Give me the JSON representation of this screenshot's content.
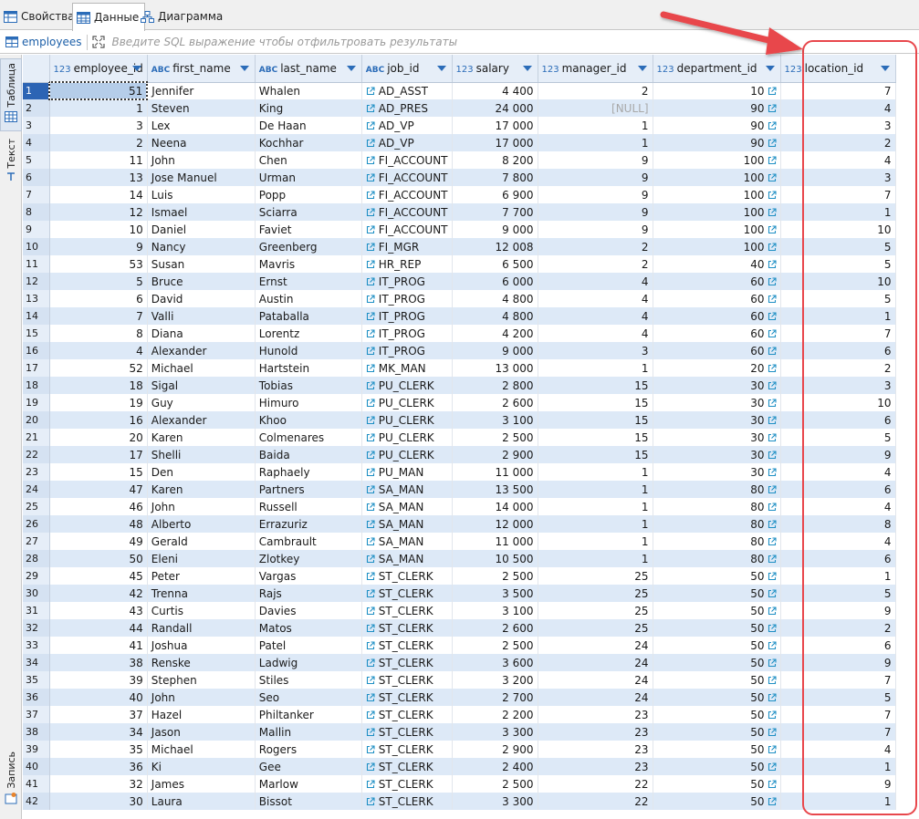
{
  "tabs": [
    {
      "label": "Свойства",
      "icon": "properties-table-icon"
    },
    {
      "label": "Данные",
      "icon": "data-grid-icon"
    },
    {
      "label": "Диаграмма",
      "icon": "diagram-icon"
    }
  ],
  "filter": {
    "entity_name": "employees",
    "placeholder": "Введите SQL выражение чтобы отфильтровать результаты"
  },
  "side_tabs": {
    "table": "Таблица",
    "text": "Текст",
    "record": "Запись"
  },
  "columns": [
    {
      "name": "employee_id",
      "type": "123"
    },
    {
      "name": "first_name",
      "type": "ABC"
    },
    {
      "name": "last_name",
      "type": "ABC"
    },
    {
      "name": "job_id",
      "type": "ABC"
    },
    {
      "name": "salary",
      "type": "123"
    },
    {
      "name": "manager_id",
      "type": "123"
    },
    {
      "name": "department_id",
      "type": "123"
    },
    {
      "name": "location_id",
      "type": "123"
    }
  ],
  "rows": [
    [
      "1",
      "51",
      "Jennifer",
      "Whalen",
      "AD_ASST",
      "4 400",
      "2",
      "10",
      "7"
    ],
    [
      "2",
      "1",
      "Steven",
      "King",
      "AD_PRES",
      "24 000",
      "[NULL]",
      "90",
      "4"
    ],
    [
      "3",
      "3",
      "Lex",
      "De Haan",
      "AD_VP",
      "17 000",
      "1",
      "90",
      "3"
    ],
    [
      "4",
      "2",
      "Neena",
      "Kochhar",
      "AD_VP",
      "17 000",
      "1",
      "90",
      "2"
    ],
    [
      "5",
      "11",
      "John",
      "Chen",
      "FI_ACCOUNT",
      "8 200",
      "9",
      "100",
      "4"
    ],
    [
      "6",
      "13",
      "Jose Manuel",
      "Urman",
      "FI_ACCOUNT",
      "7 800",
      "9",
      "100",
      "3"
    ],
    [
      "7",
      "14",
      "Luis",
      "Popp",
      "FI_ACCOUNT",
      "6 900",
      "9",
      "100",
      "7"
    ],
    [
      "8",
      "12",
      "Ismael",
      "Sciarra",
      "FI_ACCOUNT",
      "7 700",
      "9",
      "100",
      "1"
    ],
    [
      "9",
      "10",
      "Daniel",
      "Faviet",
      "FI_ACCOUNT",
      "9 000",
      "9",
      "100",
      "10"
    ],
    [
      "10",
      "9",
      "Nancy",
      "Greenberg",
      "FI_MGR",
      "12 008",
      "2",
      "100",
      "5"
    ],
    [
      "11",
      "53",
      "Susan",
      "Mavris",
      "HR_REP",
      "6 500",
      "2",
      "40",
      "5"
    ],
    [
      "12",
      "5",
      "Bruce",
      "Ernst",
      "IT_PROG",
      "6 000",
      "4",
      "60",
      "10"
    ],
    [
      "13",
      "6",
      "David",
      "Austin",
      "IT_PROG",
      "4 800",
      "4",
      "60",
      "5"
    ],
    [
      "14",
      "7",
      "Valli",
      "Pataballa",
      "IT_PROG",
      "4 800",
      "4",
      "60",
      "1"
    ],
    [
      "15",
      "8",
      "Diana",
      "Lorentz",
      "IT_PROG",
      "4 200",
      "4",
      "60",
      "7"
    ],
    [
      "16",
      "4",
      "Alexander",
      "Hunold",
      "IT_PROG",
      "9 000",
      "3",
      "60",
      "6"
    ],
    [
      "17",
      "52",
      "Michael",
      "Hartstein",
      "MK_MAN",
      "13 000",
      "1",
      "20",
      "2"
    ],
    [
      "18",
      "18",
      "Sigal",
      "Tobias",
      "PU_CLERK",
      "2 800",
      "15",
      "30",
      "3"
    ],
    [
      "19",
      "19",
      "Guy",
      "Himuro",
      "PU_CLERK",
      "2 600",
      "15",
      "30",
      "10"
    ],
    [
      "20",
      "16",
      "Alexander",
      "Khoo",
      "PU_CLERK",
      "3 100",
      "15",
      "30",
      "6"
    ],
    [
      "21",
      "20",
      "Karen",
      "Colmenares",
      "PU_CLERK",
      "2 500",
      "15",
      "30",
      "5"
    ],
    [
      "22",
      "17",
      "Shelli",
      "Baida",
      "PU_CLERK",
      "2 900",
      "15",
      "30",
      "9"
    ],
    [
      "23",
      "15",
      "Den",
      "Raphaely",
      "PU_MAN",
      "11 000",
      "1",
      "30",
      "4"
    ],
    [
      "24",
      "47",
      "Karen",
      "Partners",
      "SA_MAN",
      "13 500",
      "1",
      "80",
      "6"
    ],
    [
      "25",
      "46",
      "John",
      "Russell",
      "SA_MAN",
      "14 000",
      "1",
      "80",
      "4"
    ],
    [
      "26",
      "48",
      "Alberto",
      "Errazuriz",
      "SA_MAN",
      "12 000",
      "1",
      "80",
      "8"
    ],
    [
      "27",
      "49",
      "Gerald",
      "Cambrault",
      "SA_MAN",
      "11 000",
      "1",
      "80",
      "4"
    ],
    [
      "28",
      "50",
      "Eleni",
      "Zlotkey",
      "SA_MAN",
      "10 500",
      "1",
      "80",
      "6"
    ],
    [
      "29",
      "45",
      "Peter",
      "Vargas",
      "ST_CLERK",
      "2 500",
      "25",
      "50",
      "1"
    ],
    [
      "30",
      "42",
      "Trenna",
      "Rajs",
      "ST_CLERK",
      "3 500",
      "25",
      "50",
      "5"
    ],
    [
      "31",
      "43",
      "Curtis",
      "Davies",
      "ST_CLERK",
      "3 100",
      "25",
      "50",
      "9"
    ],
    [
      "32",
      "44",
      "Randall",
      "Matos",
      "ST_CLERK",
      "2 600",
      "25",
      "50",
      "2"
    ],
    [
      "33",
      "41",
      "Joshua",
      "Patel",
      "ST_CLERK",
      "2 500",
      "24",
      "50",
      "6"
    ],
    [
      "34",
      "38",
      "Renske",
      "Ladwig",
      "ST_CLERK",
      "3 600",
      "24",
      "50",
      "9"
    ],
    [
      "35",
      "39",
      "Stephen",
      "Stiles",
      "ST_CLERK",
      "3 200",
      "24",
      "50",
      "7"
    ],
    [
      "36",
      "40",
      "John",
      "Seo",
      "ST_CLERK",
      "2 700",
      "24",
      "50",
      "5"
    ],
    [
      "37",
      "37",
      "Hazel",
      "Philtanker",
      "ST_CLERK",
      "2 200",
      "23",
      "50",
      "7"
    ],
    [
      "38",
      "34",
      "Jason",
      "Mallin",
      "ST_CLERK",
      "3 300",
      "23",
      "50",
      "7"
    ],
    [
      "39",
      "35",
      "Michael",
      "Rogers",
      "ST_CLERK",
      "2 900",
      "23",
      "50",
      "4"
    ],
    [
      "40",
      "36",
      "Ki",
      "Gee",
      "ST_CLERK",
      "2 400",
      "23",
      "50",
      "1"
    ],
    [
      "41",
      "32",
      "James",
      "Marlow",
      "ST_CLERK",
      "2 500",
      "22",
      "50",
      "9"
    ],
    [
      "42",
      "30",
      "Laura",
      "Bissot",
      "ST_CLERK",
      "3 300",
      "22",
      "50",
      "1"
    ]
  ],
  "colors": {
    "header_bg": "#e6eef8",
    "alt_row_bg": "#dde9f7",
    "selected_row_num_bg": "#2c64b4",
    "type_icon": "#2b6cb8",
    "link_icon": "#1e8fc4",
    "annotation": "#e8474c"
  }
}
